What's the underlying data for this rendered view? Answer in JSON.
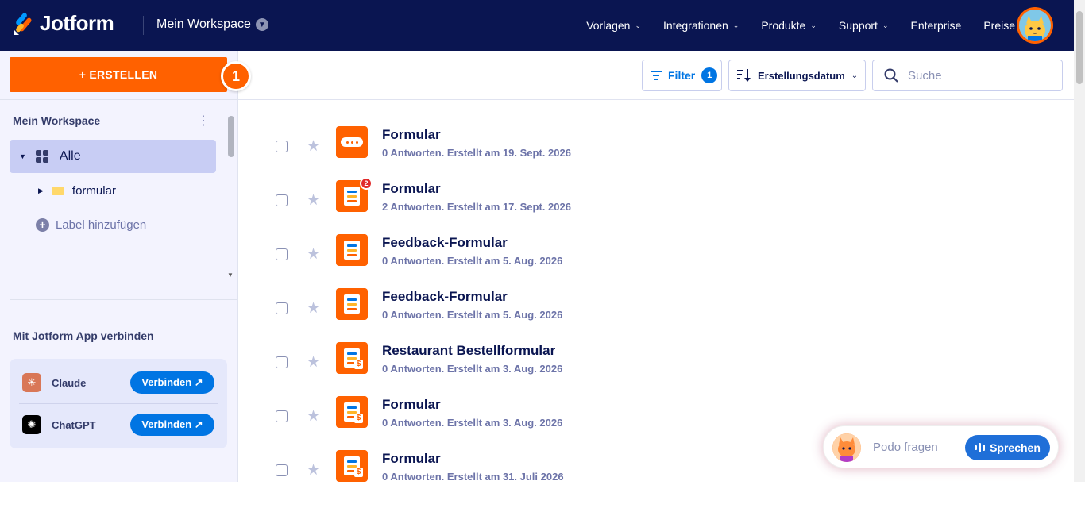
{
  "brand": {
    "name": "Jotform",
    "accent": "#ff6100",
    "navy": "#0a1551",
    "blue": "#0075e3"
  },
  "header": {
    "workspace": "Mein Workspace",
    "nav": [
      {
        "label": "Vorlagen",
        "dropdown": true
      },
      {
        "label": "Integrationen",
        "dropdown": true
      },
      {
        "label": "Produkte",
        "dropdown": true
      },
      {
        "label": "Support",
        "dropdown": true
      },
      {
        "label": "Enterprise",
        "dropdown": false
      },
      {
        "label": "Preise",
        "dropdown": false
      }
    ]
  },
  "sidebar": {
    "create_label": "+ ERSTELLEN",
    "step_number": "1",
    "workspace_title": "Mein Workspace",
    "items": [
      {
        "label": "Alle",
        "icon": "grid-icon"
      },
      {
        "label": "formular",
        "icon": "folder-icon"
      }
    ],
    "add_label": "Label hinzufügen",
    "connect_title": "Mit Jotform App verbinden",
    "apps": [
      {
        "name": "Claude",
        "button": "Verbinden ↗",
        "icon": "claude-icon"
      },
      {
        "name": "ChatGPT",
        "button": "Verbinden ↗",
        "icon": "chatgpt-icon"
      }
    ]
  },
  "toolbar": {
    "filter_label": "Filter",
    "filter_count": "1",
    "sort_label": "Erstellungsdatum",
    "search_placeholder": "Suche"
  },
  "forms": [
    {
      "title": "Formular",
      "meta": "0 Antworten. Erstellt am 19. Sept. 2026",
      "icon": "card-form-icon"
    },
    {
      "title": "Formular",
      "meta": "2 Antworten. Erstellt am 17. Sept. 2026",
      "icon": "form-icon",
      "badge": "2"
    },
    {
      "title": "Feedback-Formular",
      "meta": "0 Antworten. Erstellt am 5. Aug. 2026",
      "icon": "form-icon"
    },
    {
      "title": "Feedback-Formular",
      "meta": "0 Antworten. Erstellt am 5. Aug. 2026",
      "icon": "form-icon"
    },
    {
      "title": "Restaurant Bestellformular",
      "meta": "0 Antworten. Erstellt am 3. Aug. 2026",
      "icon": "payment-form-icon"
    },
    {
      "title": "Formular",
      "meta": "0 Antworten. Erstellt am 3. Aug. 2026",
      "icon": "payment-form-icon"
    },
    {
      "title": "Formular",
      "meta": "0 Antworten. Erstellt am 31. Juli 2026",
      "icon": "payment-form-icon"
    }
  ],
  "podo": {
    "placeholder": "Podo fragen",
    "button": "Sprechen"
  }
}
